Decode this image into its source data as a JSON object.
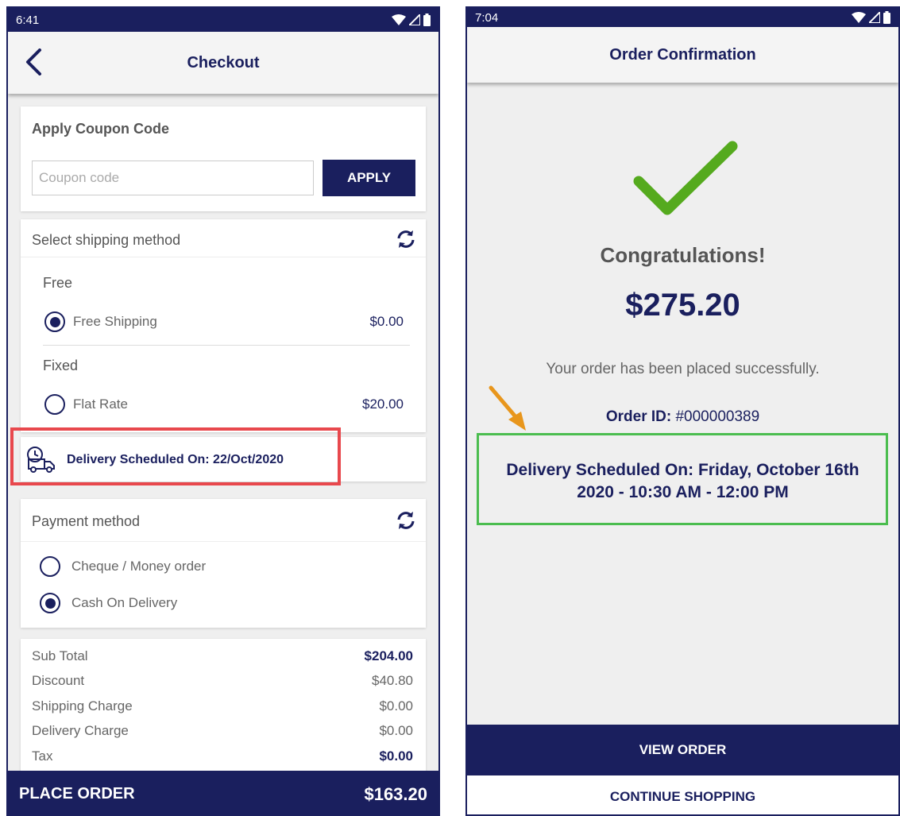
{
  "checkout": {
    "status_time": "6:41",
    "title": "Checkout",
    "coupon": {
      "title": "Apply Coupon Code",
      "placeholder": "Coupon code",
      "apply_label": "APPLY"
    },
    "shipping": {
      "title": "Select shipping method",
      "groups": [
        {
          "name": "Free",
          "option": "Free Shipping",
          "price": "$0.00",
          "selected": true
        },
        {
          "name": "Fixed",
          "option": "Flat Rate",
          "price": "$20.00",
          "selected": false
        }
      ]
    },
    "delivery_text": "Delivery Scheduled On: 22/Oct/2020",
    "payment": {
      "title": "Payment method",
      "options": [
        {
          "label": "Cheque / Money order",
          "selected": false
        },
        {
          "label": "Cash On Delivery",
          "selected": true
        }
      ]
    },
    "summary": [
      {
        "label": "Sub Total",
        "value": "$204.00"
      },
      {
        "label": "Discount",
        "value": "$40.80"
      },
      {
        "label": "Shipping Charge",
        "value": "$0.00"
      },
      {
        "label": "Delivery Charge",
        "value": "$0.00"
      },
      {
        "label": "Tax",
        "value": "$0.00"
      }
    ],
    "place_order_label": "PLACE ORDER",
    "total": "$163.20"
  },
  "confirmation": {
    "status_time": "7:04",
    "title": "Order Confirmation",
    "congrats": "Congratulations!",
    "amount": "$275.20",
    "message": "Your order has been placed successfully.",
    "order_id_label": "Order ID:",
    "order_id_value": "#000000389",
    "delivery_line1": "Delivery Scheduled On: Friday, October 16th",
    "delivery_line2": "2020 - 10:30 AM - 12:00 PM",
    "view_order_label": "VIEW ORDER",
    "continue_label": "CONTINUE SHOPPING"
  },
  "colors": {
    "navy": "#1a1f5e",
    "highlight_red": "#e8484d",
    "highlight_green": "#4bbd4f",
    "check_green": "#55aa1e",
    "arrow_orange": "#e8961c"
  },
  "icons": [
    "back-arrow-icon",
    "refresh-icon",
    "delivery-truck-icon",
    "checkmark-icon",
    "annotation-arrow-icon",
    "wifi-icon",
    "signal-icon",
    "battery-icon"
  ]
}
